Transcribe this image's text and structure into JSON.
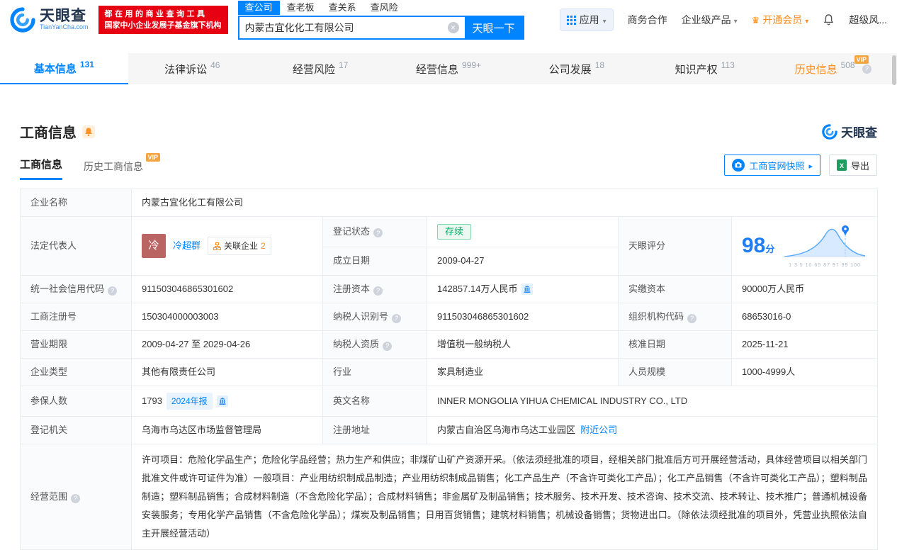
{
  "colors": {
    "brand_blue": "#0084ff",
    "vip_orange": "#ff8c1a",
    "status_green": "#00a963",
    "promo_red": "#e60012"
  },
  "labels": {
    "vip": "VIP"
  },
  "header": {
    "logo": {
      "brand": "天眼查",
      "domain": "TianYanCha.com"
    },
    "promo": {
      "line1": "都在用的商业查询工具",
      "line2": "国家中小企业发展子基金旗下机构"
    },
    "search_tabs": [
      {
        "label": "查公司"
      },
      {
        "label": "查老板"
      },
      {
        "label": "查关系"
      },
      {
        "label": "查风险"
      }
    ],
    "search": {
      "value": "内蒙古宜化化工有限公司",
      "button": "天眼一下"
    },
    "menu": {
      "apps": "应用",
      "cooperation": "商务合作",
      "enterprise": "企业级产品",
      "vip": "开通会员",
      "user": "超级风..."
    }
  },
  "nav_tabs": [
    {
      "label": "基本信息",
      "count": "131"
    },
    {
      "label": "法律诉讼",
      "count": "46"
    },
    {
      "label": "经营风险",
      "count": "17"
    },
    {
      "label": "经营信息",
      "count": "999+"
    },
    {
      "label": "公司发展",
      "count": "18"
    },
    {
      "label": "知识产权",
      "count": "113"
    },
    {
      "label": "历史信息",
      "count": "508"
    }
  ],
  "section": {
    "title": "工商信息",
    "watermark": "天眼查"
  },
  "sub_tabs": [
    {
      "label": "工商信息"
    },
    {
      "label": "历史工商信息"
    }
  ],
  "actions": {
    "snapshot": "工商官网快照",
    "export": "导出"
  },
  "score": {
    "label": "天眼评分",
    "value": "98",
    "unit": "分",
    "ticks": "1 3 5 10 65 87 97 99 100"
  },
  "fields": {
    "company_name": {
      "label": "企业名称",
      "value": "内蒙古宜化化工有限公司"
    },
    "legal_rep": {
      "label": "法定代表人",
      "avatar": "冷",
      "name": "冷超群",
      "related": "关联企业",
      "related_count": "2"
    },
    "reg_status": {
      "label": "登记状态",
      "value": "存续"
    },
    "establish_date": {
      "label": "成立日期",
      "value": "2009-04-27"
    },
    "credit_code": {
      "label": "统一社会信用代码",
      "value": "911503046865301602"
    },
    "reg_capital": {
      "label": "注册资本",
      "value": "142857.14万人民币"
    },
    "paid_capital": {
      "label": "实缴资本",
      "value": "90000万人民币"
    },
    "reg_number": {
      "label": "工商注册号",
      "value": "150304000003003"
    },
    "taxpayer_id": {
      "label": "纳税人识别号",
      "value": "911503046865301602"
    },
    "org_code": {
      "label": "组织机构代码",
      "value": "68653016-0"
    },
    "business_term": {
      "label": "营业期限",
      "value": "2009-04-27 至 2029-04-26"
    },
    "taxpayer_quality": {
      "label": "纳税人资质",
      "value": "增值税一般纳税人"
    },
    "approval_date": {
      "label": "核准日期",
      "value": "2025-11-21"
    },
    "company_type": {
      "label": "企业类型",
      "value": "其他有限责任公司"
    },
    "industry": {
      "label": "行业",
      "value": "家具制造业"
    },
    "staff_size": {
      "label": "人员规模",
      "value": "1000-4999人"
    },
    "insured": {
      "label": "参保人数",
      "value": "1793",
      "report": "2024年报"
    },
    "english_name": {
      "label": "英文名称",
      "value": "INNER MONGOLIA YIHUA CHEMICAL INDUSTRY CO., LTD"
    },
    "reg_authority": {
      "label": "登记机关",
      "value": "乌海市乌达区市场监督管理局"
    },
    "reg_address": {
      "label": "注册地址",
      "value": "内蒙古自治区乌海市乌达工业园区",
      "nearby": "附近公司"
    },
    "business_scope": {
      "label": "经营范围",
      "value": "许可项目：危险化学品生产；危险化学品经营；热力生产和供应；非煤矿山矿产资源开采。（依法须经批准的项目，经相关部门批准后方可开展经营活动，具体经营项目以相关部门批准文件或许可证件为准）一般项目：产业用纺织制成品制造；产业用纺织制成品销售；化工产品生产（不含许可类化工产品）；化工产品销售（不含许可类化工产品）；塑料制品制造；塑料制品销售；合成材料制造（不含危险化学品）；合成材料销售；非金属矿及制品销售；技术服务、技术开发、技术咨询、技术交流、技术转让、技术推广；普通机械设备安装服务；专用化学产品销售（不含危险化学品）；煤炭及制品销售；日用百货销售；建筑材料销售；机械设备销售；货物进出口。（除依法须经批准的项目外，凭营业执照依法自主开展经营活动）"
    }
  }
}
